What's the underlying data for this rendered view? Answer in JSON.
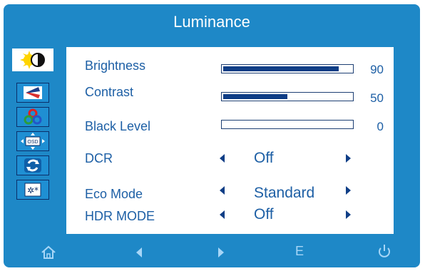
{
  "osd": {
    "title": "Luminance",
    "menu_tabs": [
      {
        "name": "luminance",
        "icon": "sun-moon-icon",
        "selected": true
      },
      {
        "name": "image-setup",
        "icon": "flag-icon",
        "selected": false
      },
      {
        "name": "color",
        "icon": "color-wheel-icon",
        "selected": false
      },
      {
        "name": "osd-setup",
        "icon": "osd-icon",
        "selected": false
      },
      {
        "name": "reset",
        "icon": "reset-icon",
        "selected": false
      },
      {
        "name": "misc",
        "icon": "misc-icon",
        "selected": false
      }
    ],
    "items": {
      "brightness": {
        "label": "Brightness",
        "value": "90",
        "level": 0.9
      },
      "contrast": {
        "label": "Contrast",
        "value": "50",
        "level": 0.5
      },
      "black_level": {
        "label": "Black Level",
        "value": "0",
        "level": 0.0
      },
      "dcr": {
        "label": "DCR",
        "value": "Off"
      },
      "eco_mode": {
        "label": "Eco Mode",
        "value": "Standard"
      },
      "hdr_mode": {
        "label": "HDR MODE",
        "value": "Off"
      }
    },
    "bottom_buttons": [
      {
        "name": "home",
        "icon": "home-icon"
      },
      {
        "name": "left",
        "icon": "left-arrow-icon"
      },
      {
        "name": "right",
        "icon": "right-arrow-icon"
      },
      {
        "name": "enter",
        "icon": "E"
      },
      {
        "name": "power",
        "icon": "power-icon"
      }
    ],
    "colors": {
      "frame": "#1e88c7",
      "text": "#1d5fa5",
      "bar": "#0f3e86",
      "bottom_icons": "#a7d6f7"
    }
  }
}
